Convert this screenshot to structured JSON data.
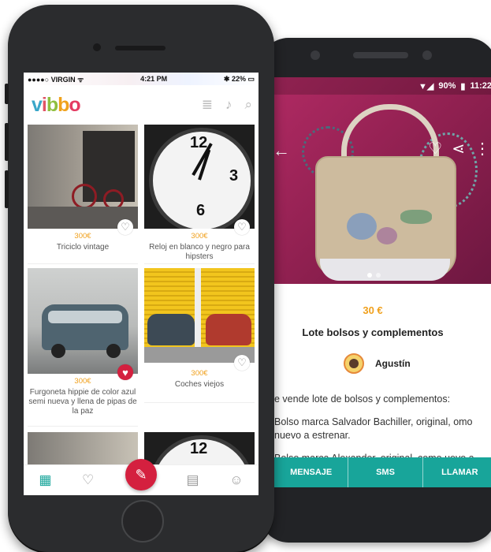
{
  "colors": {
    "accent": "#18a59a",
    "price": "#f0a01c",
    "favorite": "#d4203f",
    "brand_logo": [
      "#3aa7c9",
      "#e05466",
      "#8fbf3f",
      "#f0a21c",
      "#e43b62"
    ]
  },
  "iphone": {
    "status": {
      "carrier": "●●●●○ VIRGIN ᯤ",
      "time": "4:21 PM",
      "battery": "✱ 22% ▭"
    },
    "logo": {
      "v": "v",
      "i": "i",
      "b1": "b",
      "b2": "b",
      "o": "o"
    },
    "header_icons": [
      "menu-icon",
      "bell-icon",
      "search-icon"
    ],
    "listings": [
      {
        "price": "300€",
        "title": "Triciclo vintage",
        "favorite": false
      },
      {
        "price": "300€",
        "title": "Reloj en blanco y negro para hipsters",
        "favorite": false
      },
      {
        "price": "300€",
        "title": "Furgoneta hippie de color azul semi nueva y llena de pipas de la paz",
        "favorite": true
      },
      {
        "price": "300€",
        "title": "Coches viejos",
        "favorite": false
      }
    ],
    "clock_numbers": {
      "twelve": "12",
      "three": "3",
      "six": "6"
    },
    "tabbar": [
      "grid-icon",
      "hearts-icon",
      "chat-icon",
      "user-icon"
    ],
    "fab_icon": "compose-icon"
  },
  "android": {
    "status": {
      "signal": "▼◢",
      "battery": "90%",
      "time": "11:22"
    },
    "detail": {
      "price": "30 €",
      "title": "Lote bolsos y complementos",
      "user": "Agustín",
      "desc_1": "e vende lote de bolsos y complementos:",
      "desc_2": "Bolso marca Salvador Bachiller, original, omo nuevo a estrenar.",
      "desc_3": "Bolso marca Alexander, original, como uevo a estrenar."
    },
    "actions": {
      "message": "MENSAJE",
      "sms": "SMS",
      "call": "LLAMAR"
    }
  }
}
